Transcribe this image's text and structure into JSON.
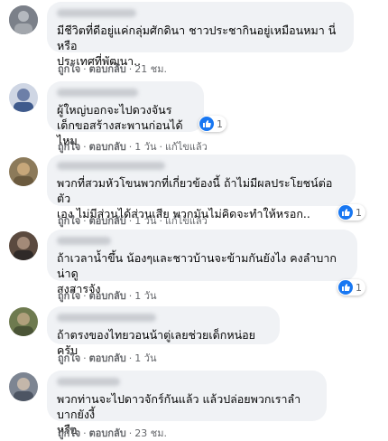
{
  "comments": [
    {
      "text": "มีชีวิตที่ดีอยู่แค่กลุ่มศักดินา ชาวประชากินอยู่เหมือนหมา นี่หรือ\nประเทศที่พัฒนา..",
      "like": "ถูกใจ",
      "reply": "ตอบกลับ",
      "time": "21 ชม.",
      "edited": "",
      "reactions": ""
    },
    {
      "text": "ผู้ใหญ่บอกจะไปดวงจันร\nเด็กขอสร้างสะพานก่อนได้ไหม",
      "like": "ถูกใจ",
      "reply": "ตอบกลับ",
      "time": "1 วัน",
      "edited": "แก้ไขแล้ว",
      "reactions": "1"
    },
    {
      "text": "พวกที่สวมหัวโขนพวกที่เกี่ยวข้องนี้ ถ้าไม่มีผลประโยชน์ต่อตัว\nเอง ไม่มีส่วนได้ส่วนเสีย พวกมันไม่คิดจะทำให้หรอก..",
      "like": "ถูกใจ",
      "reply": "ตอบกลับ",
      "time": "1 วัน",
      "edited": "แก้ไขแล้ว",
      "reactions": "1"
    },
    {
      "text": "ถ้าเวลาน้ำขึ้น น้องๆและชาวบ้านจะข้ามกันยังไง คงลำบากน่าดู\nสงสารจัง",
      "like": "ถูกใจ",
      "reply": "ตอบกลับ",
      "time": "1 วัน",
      "edited": "",
      "reactions": "1"
    },
    {
      "text": "ถ้าตรงของไทยวอนน้าตู่เลยช่วยเด็กหน่อยครับ",
      "like": "ถูกใจ",
      "reply": "ตอบกลับ",
      "time": "1 วัน",
      "edited": "",
      "reactions": ""
    },
    {
      "text": "พวกท่านจะไปดาวจักร์กันแล้ว แล้วปล่อยพวกเราลำบากยังงี้\nหรือ",
      "like": "ถูกใจ",
      "reply": "ตอบกลับ",
      "time": "23 ชม.",
      "edited": "",
      "reactions": ""
    }
  ],
  "colors": {
    "bubble": "#f0f2f5",
    "like_icon": "#1877f2",
    "meta_text": "#65676b"
  },
  "icons": {
    "reaction": "thumbs-up-icon"
  }
}
